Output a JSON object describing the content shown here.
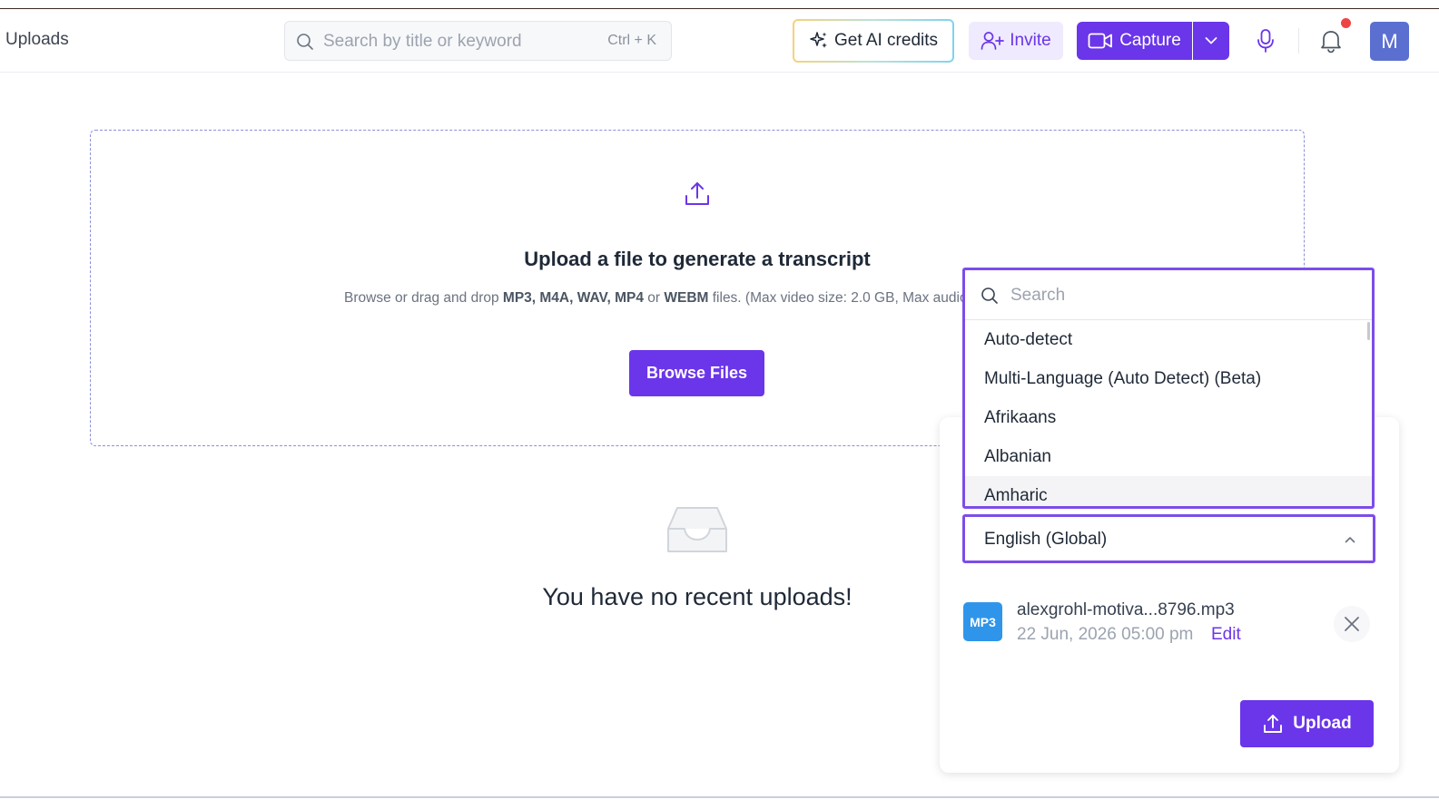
{
  "header": {
    "title": "Uploads",
    "search": {
      "placeholder": "Search by title or keyword",
      "shortcut": "Ctrl + K",
      "icon": "search-icon"
    },
    "credits_label": "Get AI credits",
    "invite_label": "Invite",
    "capture_label": "Capture",
    "avatar_initial": "M",
    "notification_dot_color": "#ef4444"
  },
  "dropzone": {
    "icon": "upload-icon",
    "title": "Upload a file to generate a transcript",
    "subtitle_prefix": "Browse or drag and drop ",
    "formats_1": "MP3, M4A, WAV, MP4",
    "or": " or ",
    "formats_2": "WEBM",
    "subtitle_suffix": " files. (Max video size: 2.0 GB, Max audio",
    "browse_label": "Browse Files"
  },
  "empty_state": {
    "icon": "inbox-icon",
    "message": "You have no recent uploads!"
  },
  "language": {
    "search_placeholder": "Search",
    "options": [
      "Auto-detect",
      "Multi-Language (Auto Detect) (Beta)",
      "Afrikaans",
      "Albanian",
      "Amharic"
    ],
    "selected": "English (Global)"
  },
  "file": {
    "badge": "MP3",
    "name": "alexgrohl-motiva...8796.mp3",
    "date": "22 Jun, 2026 05:00 pm",
    "edit_label": "Edit"
  },
  "upload_label": "Upload",
  "colors": {
    "accent": "#6b35ea",
    "focus_border": "#7c4dea",
    "mp3_badge": "#2f95ea"
  }
}
